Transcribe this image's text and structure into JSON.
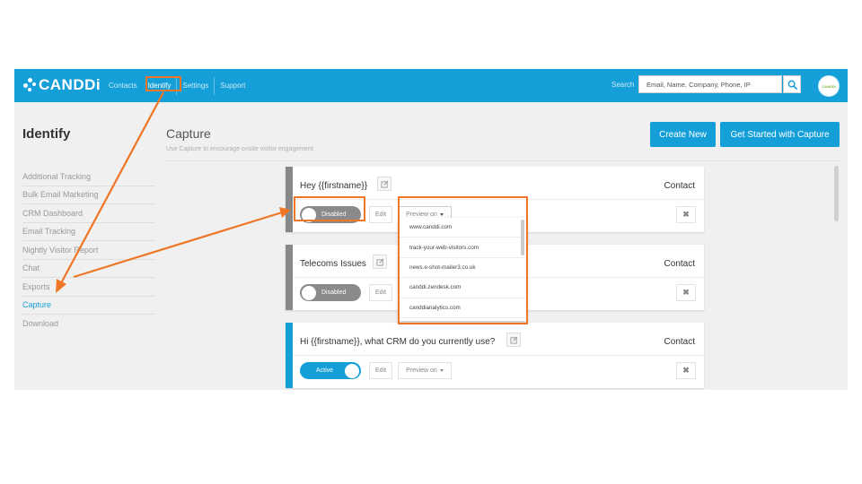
{
  "colors": {
    "brand": "#159fd9",
    "annotation": "#ee7625",
    "toggle_off": "#8a8a8a",
    "accent_gray": "#888888"
  },
  "topbar": {
    "logo_text": "CANDDi",
    "nav": [
      {
        "label": "Contacts",
        "active": false
      },
      {
        "label": "Identify",
        "active": true
      },
      {
        "label": "Settings",
        "active": false
      },
      {
        "label": "Support",
        "active": false
      }
    ],
    "search_label": "Search",
    "search_placeholder": "Email, Name, Company, Phone, IP",
    "avatar_text": "CANDDi"
  },
  "sidebar": {
    "title": "Identify",
    "items": [
      {
        "label": "Additional Tracking",
        "active": false
      },
      {
        "label": "Bulk Email Marketing",
        "active": false
      },
      {
        "label": "CRM Dashboard",
        "active": false
      },
      {
        "label": "Email Tracking",
        "active": false
      },
      {
        "label": "Nightly Visitor Report",
        "active": false
      },
      {
        "label": "Chat",
        "active": false
      },
      {
        "label": "Exports",
        "active": false
      },
      {
        "label": "Capture",
        "active": true
      },
      {
        "label": "Download",
        "active": false
      }
    ]
  },
  "main": {
    "title": "Capture",
    "subtitle": "Use Capture to encourage onsite visitor engagement",
    "create_new": "Create New",
    "get_started": "Get Started with Capture"
  },
  "cards": [
    {
      "title": "Hey {{firstname}}",
      "type_label": "Contact",
      "status": "Disabled",
      "active": false,
      "edit": "Edit",
      "preview": "Preview on",
      "close": "✖"
    },
    {
      "title": "Telecoms Issues",
      "type_label": "Contact",
      "status": "Disabled",
      "active": false,
      "edit": "Edit",
      "preview": "Preview on",
      "close": "✖"
    },
    {
      "title": "Hi {{firstname}}, what CRM do you currently use?",
      "type_label": "Contact",
      "status": "Active",
      "active": true,
      "edit": "Edit",
      "preview": "Preview on",
      "close": "✖"
    }
  ],
  "dropdown": {
    "items": [
      "www.canddi.com",
      "track-your-web-visitors.com",
      "news.e-shot-mailer3.co.uk",
      "canddi.zendesk.com",
      "canddianalytics.com"
    ]
  },
  "icons": {
    "logo": "canddi-dots-icon",
    "search": "search-icon",
    "edit": "pencil-square-icon",
    "close": "close-icon"
  }
}
